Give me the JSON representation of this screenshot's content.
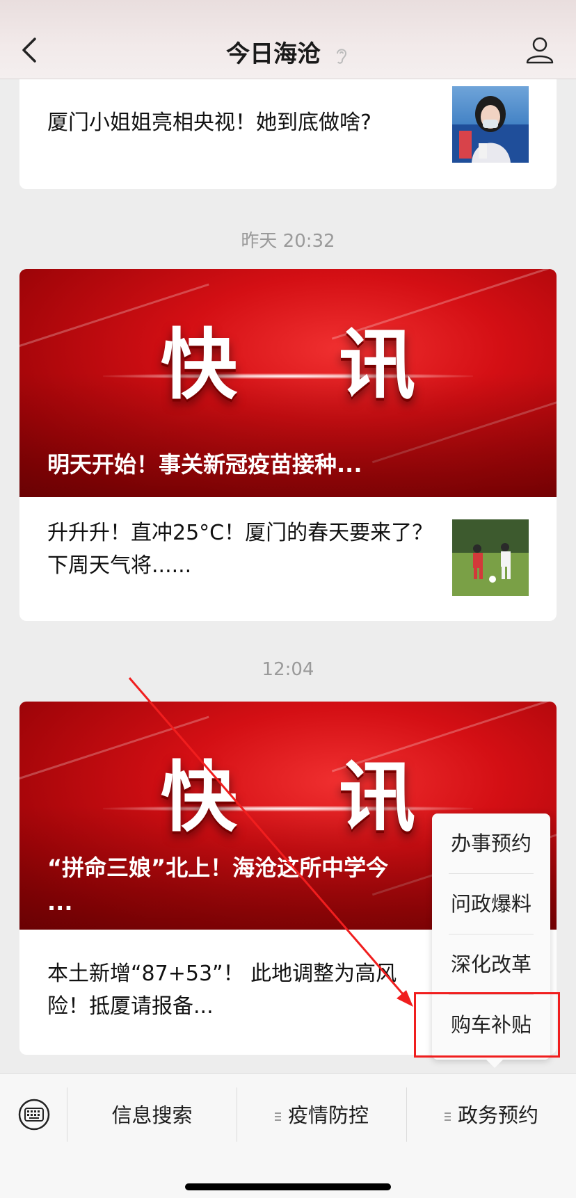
{
  "header": {
    "title": "今日海沧",
    "icons": [
      "back-arrow-icon",
      "ear-icon",
      "profile-icon"
    ]
  },
  "feed": [
    {
      "type": "partial_card",
      "items": [
        {
          "text": "厦门小姐姐亮相央视！她到底做啥?",
          "thumb": "woman-interview-photo"
        }
      ]
    },
    {
      "timestamp": "昨天 20:32",
      "banner": {
        "big_text": "快 讯",
        "caption": "明天开始！事关新冠疫苗接种..."
      },
      "items": [
        {
          "text": "升升升！直冲25°C！厦门的春天要来了？下周天气将......",
          "thumb": "children-soccer-photo"
        }
      ]
    },
    {
      "timestamp": "12:04",
      "banner": {
        "big_text": "快 讯",
        "caption": "“拼命三娘”北上！海沧这所中学今",
        "caption_line2": "..."
      },
      "items": [
        {
          "text": "本土新增“87+53”！ 此地调整为高风险！抵厦请报备..."
        }
      ]
    }
  ],
  "popup_menu": {
    "items": [
      "办事预约",
      "问政爆料",
      "深化改革",
      "购车补贴"
    ],
    "highlighted": "购车补贴",
    "highlight_color": "#f01e1e"
  },
  "bottom_menu": {
    "keyboard_icon": "keyboard-icon",
    "items": [
      "信息搜索",
      "疫情防控",
      "政务预约"
    ]
  },
  "colors": {
    "banner_red": "#d40f14",
    "background": "#ededed",
    "annotation_red": "#f01e1e"
  }
}
